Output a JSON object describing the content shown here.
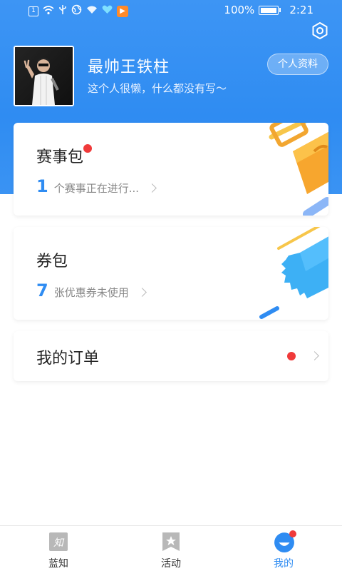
{
  "status_bar": {
    "battery": "100%",
    "time": "2:21"
  },
  "profile": {
    "username": "最帅王铁柱",
    "bio": "这个人很懒，什么都没有写～",
    "profile_button": "个人资料"
  },
  "cards": {
    "events": {
      "title": "赛事包",
      "count": "1",
      "text": "个赛事正在进行..."
    },
    "coupons": {
      "title": "券包",
      "count": "7",
      "text": "张优惠券未使用"
    },
    "orders": {
      "title": "我的订单"
    }
  },
  "tabbar": {
    "tabs": [
      {
        "label": "蓝知",
        "icon": "zhi-icon"
      },
      {
        "label": "活动",
        "icon": "star-bookmark-icon"
      },
      {
        "label": "我的",
        "icon": "my-face-icon"
      }
    ],
    "active_color": "#2f8cf2"
  },
  "colors": {
    "header_blue": "#2f8cf2",
    "accent_red": "#f03a3a",
    "count_blue": "#2f8cf2"
  }
}
